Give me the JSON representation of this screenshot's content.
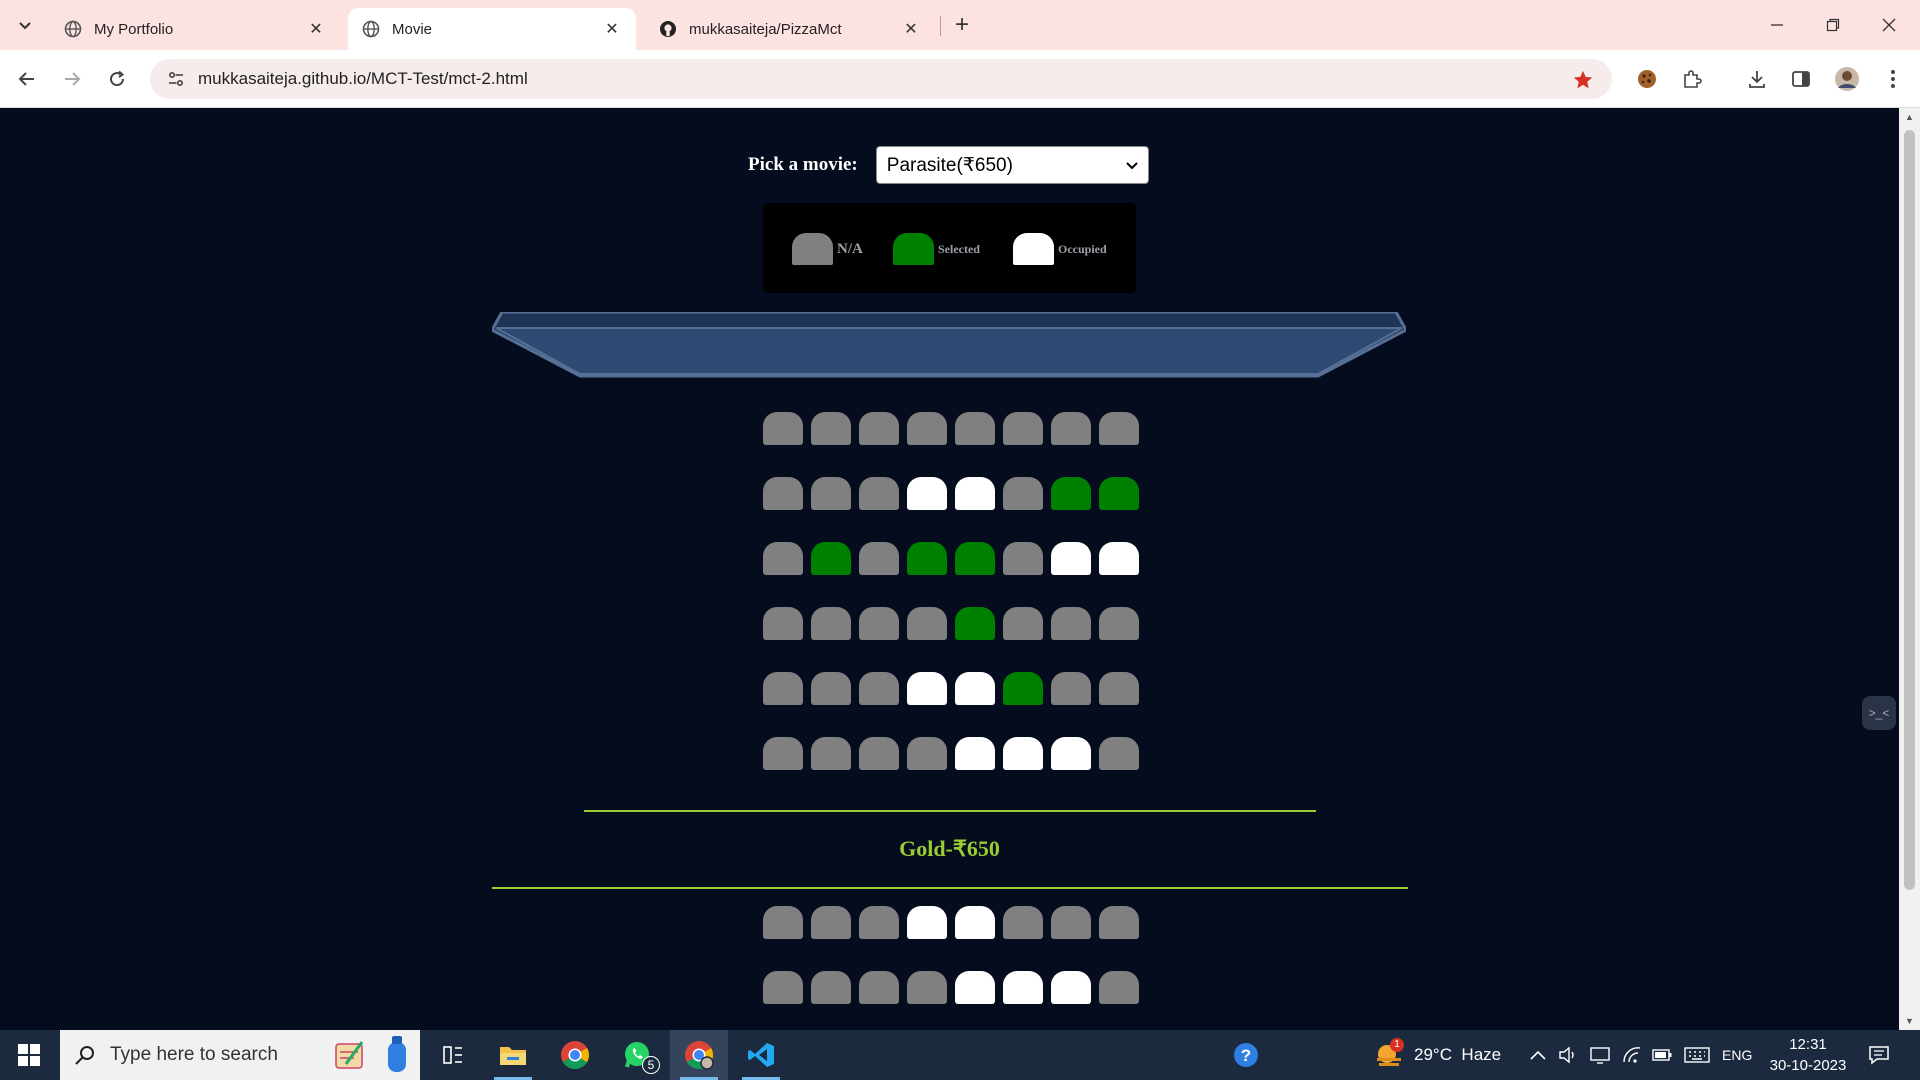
{
  "browser": {
    "tabs": [
      {
        "title": "My Portfolio",
        "active": false
      },
      {
        "title": "Movie",
        "active": true
      },
      {
        "title": "mukkasaiteja/PizzaMct",
        "active": false
      }
    ],
    "url": "mukkasaiteja.github.io/MCT-Test/mct-2.html",
    "accent_color": "#d93025"
  },
  "page": {
    "picker_label": "Pick a movie:",
    "selected_movie": "Parasite(₹650)",
    "legend": [
      {
        "label": "N/A",
        "status": "na",
        "color": "#808080"
      },
      {
        "label": "Selected",
        "status": "selected",
        "color": "#008000"
      },
      {
        "label": "Occupied",
        "status": "occupied",
        "color": "#ffffff"
      }
    ],
    "seat_rows": [
      [
        "na",
        "na",
        "na",
        "na",
        "na",
        "na",
        "na",
        "na"
      ],
      [
        "na",
        "na",
        "na",
        "occupied",
        "occupied",
        "na",
        "selected",
        "selected"
      ],
      [
        "na",
        "selected",
        "na",
        "selected",
        "selected",
        "na",
        "occupied",
        "occupied"
      ],
      [
        "na",
        "na",
        "na",
        "na",
        "selected",
        "na",
        "na",
        "na"
      ],
      [
        "na",
        "na",
        "na",
        "occupied",
        "occupied",
        "selected",
        "na",
        "na"
      ],
      [
        "na",
        "na",
        "na",
        "na",
        "occupied",
        "occupied",
        "occupied",
        "na"
      ]
    ],
    "category_label": "Gold-₹650",
    "gold_rows": [
      [
        "na",
        "na",
        "na",
        "occupied",
        "occupied",
        "na",
        "na",
        "na"
      ],
      [
        "na",
        "na",
        "na",
        "na",
        "occupied",
        "occupied",
        "occupied",
        "na"
      ]
    ]
  },
  "taskbar": {
    "search_placeholder": "Type here to search",
    "whatsapp_badge": "5",
    "weather": "29°C  Haze",
    "weather_badge": "1",
    "language": "ENG",
    "time": "12:31",
    "date": "30-10-2023"
  }
}
